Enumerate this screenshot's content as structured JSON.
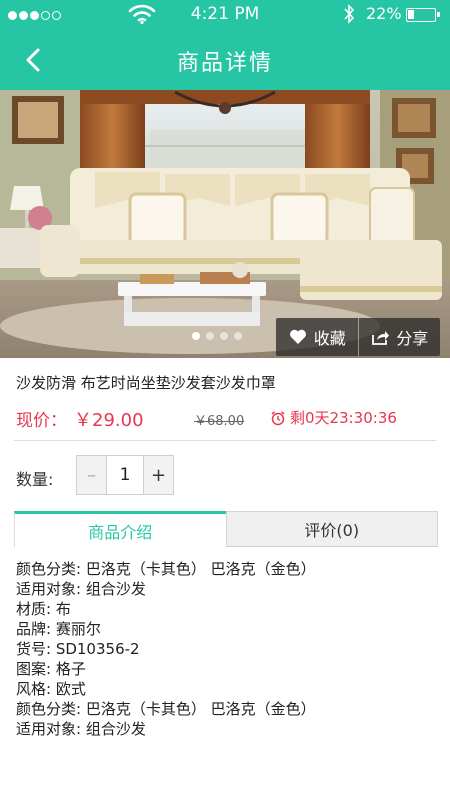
{
  "status_bar": {
    "time": "4:21 PM",
    "battery": "22%",
    "battery_level": 0.22
  },
  "nav": {
    "title": "商品详情",
    "back_icon": "chevron-left-icon"
  },
  "colors": {
    "accent": "#26c6a5",
    "price": "#e8364f"
  },
  "gallery": {
    "current_page": 1,
    "page_count": 4
  },
  "actions": {
    "favorite_label": "收藏",
    "share_label": "分享"
  },
  "product": {
    "name": "沙发防滑 布艺时尚坐垫沙发套沙发巾罩",
    "price_label": "现价：",
    "price": "￥29.00",
    "original_price": "￥68.00",
    "countdown": "剩0天23:30:36"
  },
  "quantity": {
    "label": "数量:",
    "value": "1",
    "minus": "–",
    "plus": "+"
  },
  "tabs": [
    {
      "label": "商品介绍",
      "active": true
    },
    {
      "label": "评价(0)",
      "active": false
    }
  ],
  "specs": [
    "颜色分类: 巴洛克（卡其色） 巴洛克（金色）",
    "适用对象: 组合沙发",
    "材质: 布",
    "品牌: 赛丽尔",
    "货号: SD10356-2",
    "图案: 格子",
    "风格: 欧式",
    "颜色分类: 巴洛克（卡其色） 巴洛克（金色）",
    "适用对象: 组合沙发"
  ]
}
